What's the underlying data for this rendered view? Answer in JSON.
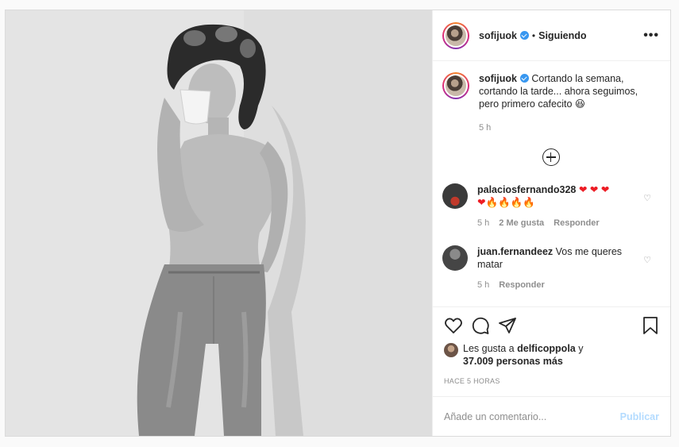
{
  "post": {
    "author": "sofijuok",
    "separator": "•",
    "follow_status": "Siguiendo",
    "more": "•••",
    "caption": "Cortando la semana, cortando la tarde... ahora seguimos, pero primero cafecito",
    "caption_emoji": "😆",
    "caption_time": "5 h"
  },
  "comments": [
    {
      "user": "palaciosfernando328",
      "text_line1": "❤ ❤ ❤",
      "text_line2_hearts": "❤",
      "text_line2_fire": "🔥🔥🔥🔥",
      "time": "5 h",
      "likes": "2 Me gusta",
      "reply": "Responder"
    },
    {
      "user": "juan.fernandeez",
      "text": "Vos me queres matar",
      "time": "5 h",
      "reply": "Responder"
    }
  ],
  "likes": {
    "prefix": "Les gusta a",
    "user": "delficoppola",
    "conjunction": "y",
    "count": "37.009 personas más"
  },
  "timestamp": "HACE 5 HORAS",
  "add_comment": {
    "placeholder": "Añade un comentario...",
    "publish": "Publicar"
  },
  "icons": {
    "like": "heart-icon",
    "comment": "comment-icon",
    "share": "share-icon",
    "save": "bookmark-icon"
  }
}
